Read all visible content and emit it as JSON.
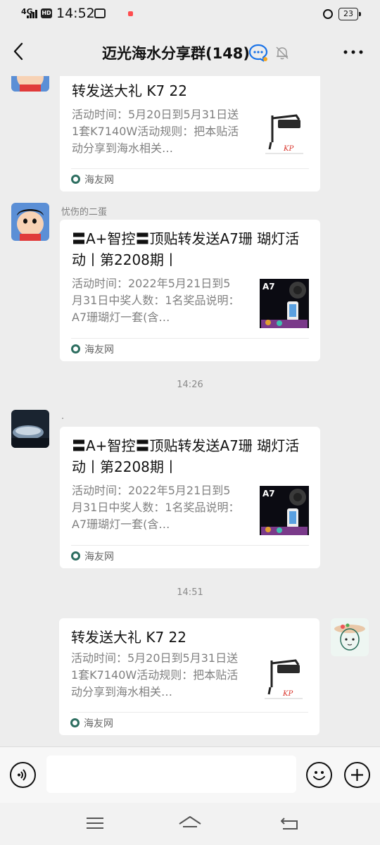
{
  "status_bar": {
    "network": "4G",
    "hd": "HD",
    "time": "14:52",
    "battery": "23"
  },
  "header": {
    "title": "迈光海水分享群(148)"
  },
  "messages": [
    {
      "card": {
        "title": "转发送大礼 K7 22",
        "desc": "活动时间：5月20日到5月31日送1套K7140W活动规则：把本贴活动分享到海水相关…",
        "source": "海友网"
      }
    },
    {
      "sender": "忧伤的二蛋",
      "card": {
        "title": "〓A+智控〓顶贴转发送A7珊 瑚灯活动丨第2208期丨",
        "desc": "活动时间：2022年5月21日到5月31日中奖人数：1名奖品说明：A7珊瑚灯一套(含…",
        "source": "海友网"
      }
    },
    {
      "time": "14:26"
    },
    {
      "sender": ".",
      "card": {
        "title": "〓A+智控〓顶贴转发送A7珊 瑚灯活动丨第2208期丨",
        "desc": "活动时间：2022年5月21日到5月31日中奖人数：1名奖品说明：A7珊瑚灯一套(含…",
        "source": "海友网"
      }
    },
    {
      "time": "14:51"
    },
    {
      "card": {
        "title": "转发送大礼 K7 22",
        "desc": "活动时间：5月20日到5月31日送1套K7140W活动规则：把本贴活动分享到海水相关…",
        "source": "海友网"
      }
    }
  ],
  "thumbs": {
    "k7_brand": "KP",
    "a7_label": "A7"
  },
  "input": {
    "value": ""
  },
  "colors": {
    "background": "#ededed",
    "card": "#ffffff",
    "accent_blue": "#1a73e8"
  }
}
